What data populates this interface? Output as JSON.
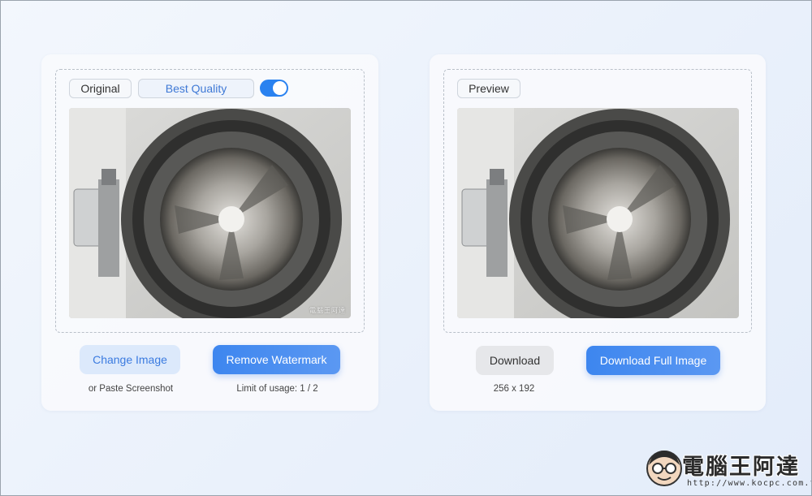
{
  "left_panel": {
    "original_label": "Original",
    "quality_label": "Best Quality",
    "quality_toggle_on": true,
    "change_image_label": "Change Image",
    "remove_watermark_label": "Remove Watermark",
    "paste_hint": "or Paste Screenshot",
    "usage_limit": "Limit of usage: 1 / 2",
    "image_watermark": "電腦王阿達"
  },
  "right_panel": {
    "preview_label": "Preview",
    "download_label": "Download",
    "download_full_label": "Download Full Image",
    "image_size": "256 x 192"
  },
  "site_logo": {
    "brand": "電腦王阿達",
    "url": "http://www.kocpc.com.tw"
  },
  "colors": {
    "accent": "#3d86ef",
    "soft_button": "#dce9fb",
    "toggle": "#2a82f0"
  }
}
